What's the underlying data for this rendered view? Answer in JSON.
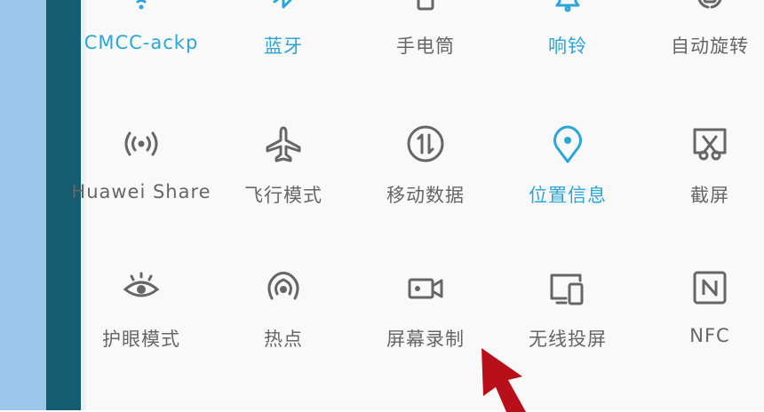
{
  "colors": {
    "active": "#2ba6d8",
    "inactive": "#666666",
    "arrow": "#b8101a"
  },
  "quick_settings": {
    "rows": [
      [
        {
          "label": "CMCC-ackp",
          "icon": "wifi-icon",
          "active": true
        },
        {
          "label": "蓝牙",
          "icon": "bluetooth-icon",
          "active": true
        },
        {
          "label": "手电筒",
          "icon": "flashlight-icon",
          "active": false
        },
        {
          "label": "响铃",
          "icon": "bell-icon",
          "active": true
        },
        {
          "label": "自动旋转",
          "icon": "auto-rotate-icon",
          "active": false
        }
      ],
      [
        {
          "label": "Huawei Share",
          "icon": "huawei-share-icon",
          "active": false
        },
        {
          "label": "飞行模式",
          "icon": "airplane-icon",
          "active": false
        },
        {
          "label": "移动数据",
          "icon": "mobile-data-icon",
          "active": false
        },
        {
          "label": "位置信息",
          "icon": "location-icon",
          "active": true
        },
        {
          "label": "截屏",
          "icon": "screenshot-icon",
          "active": false
        }
      ],
      [
        {
          "label": "护眼模式",
          "icon": "eye-comfort-icon",
          "active": false
        },
        {
          "label": "热点",
          "icon": "hotspot-icon",
          "active": false
        },
        {
          "label": "屏幕录制",
          "icon": "screen-record-icon",
          "active": false
        },
        {
          "label": "无线投屏",
          "icon": "wireless-projection-icon",
          "active": false
        },
        {
          "label": "NFC",
          "icon": "nfc-icon",
          "active": false
        }
      ]
    ]
  }
}
